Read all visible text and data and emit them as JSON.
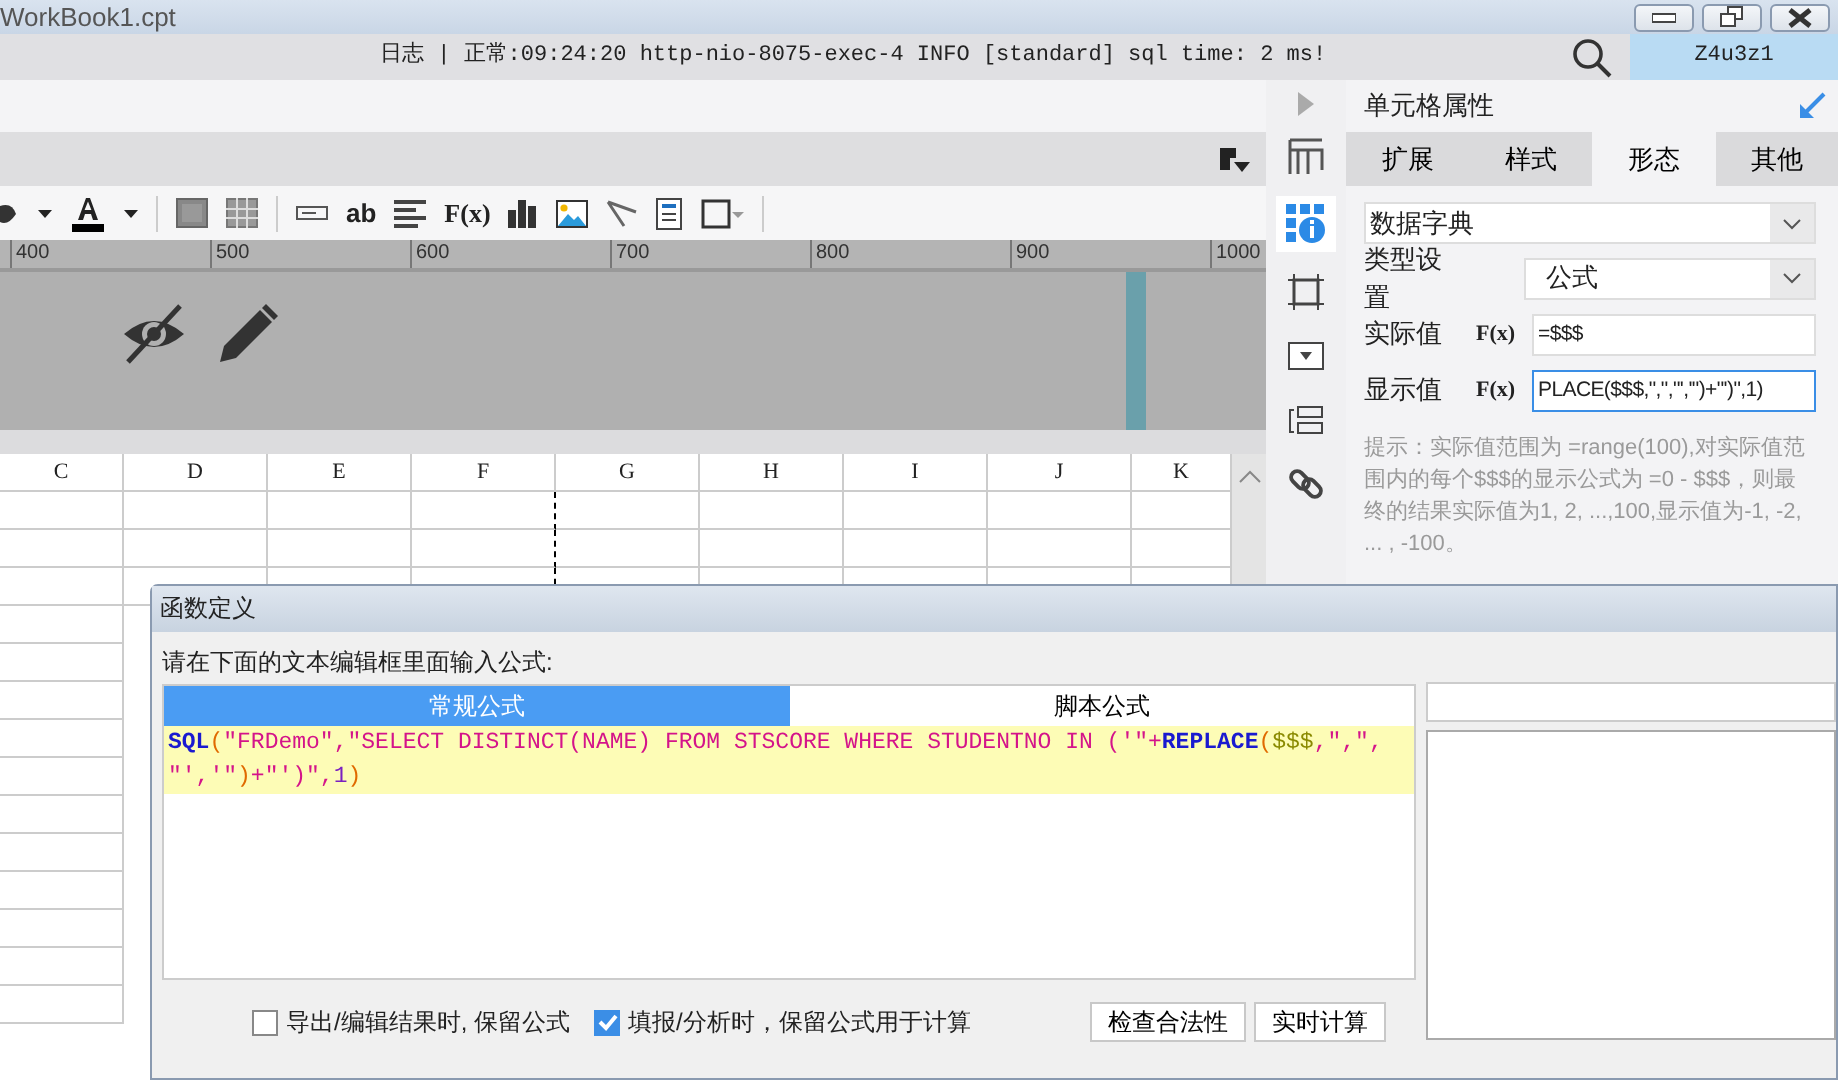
{
  "window": {
    "title": "WorkBook1.cpt"
  },
  "log_bar": {
    "label": "日志",
    "separator": "|",
    "message": "正常:09:24:20 http-nio-8075-exec-4 INFO [standard] sql time: 2 ms!",
    "user": "Z4u3z1"
  },
  "toolbar": {
    "text_tool": "ab",
    "formula_tool": "F(x)"
  },
  "ruler": {
    "ticks": [
      "400",
      "500",
      "600",
      "700",
      "800",
      "900",
      "1000"
    ]
  },
  "sheet": {
    "columns": [
      "C",
      "D",
      "E",
      "F",
      "G",
      "H",
      "I",
      "J",
      "K"
    ]
  },
  "property_panel": {
    "title": "单元格属性",
    "tabs": [
      {
        "label": "扩展",
        "selected": false
      },
      {
        "label": "样式",
        "selected": false
      },
      {
        "label": "形态",
        "selected": true
      },
      {
        "label": "其他",
        "selected": false
      }
    ],
    "form_type": "数据字典",
    "type_label": "类型设置",
    "type_value": "公式",
    "fields": [
      {
        "label": "实际值",
        "fx": "F(x)",
        "value": "=$$$",
        "focused": false
      },
      {
        "label": "显示值",
        "fx": "F(x)",
        "value": "PLACE($$$,\",\",\"','\")+\"')\",1)",
        "focused": true
      }
    ],
    "hint": "提示：实际值范围为 =range(100),对实际值范围内的每个$$$的显示公式为 =0 - $$$，则最终的结果实际值为1, 2, ...,100,显示值为-1, -2, ... , -100。"
  },
  "dialog": {
    "title": "函数定义",
    "prompt": "请在下面的文本编辑框里面输入公式:",
    "tabs": [
      {
        "label": "常规公式",
        "selected": true
      },
      {
        "label": "脚本公式",
        "selected": false
      }
    ],
    "formula_lines": [
      [
        {
          "text": "SQL",
          "kind": "function"
        },
        {
          "text": "(",
          "kind": "paren"
        },
        {
          "text": "\"FRDemo\",\"SELECT DISTINCT(NAME) FROM STSCORE WHERE STUDENTNO IN ('\"+",
          "kind": "string"
        },
        {
          "text": "REPLACE",
          "kind": "function"
        },
        {
          "text": "(",
          "kind": "paren"
        },
        {
          "text": "$$$",
          "kind": "parameter"
        },
        {
          "text": ",\",\",",
          "kind": "string"
        }
      ],
      [
        {
          "text": "\"','\"",
          "kind": "string"
        },
        {
          "text": ")",
          "kind": "paren"
        },
        {
          "text": "+\"')\",",
          "kind": "string"
        },
        {
          "text": "1",
          "kind": "number"
        },
        {
          "text": ")",
          "kind": "paren"
        }
      ]
    ],
    "options": [
      {
        "label": "导出/编辑结果时, 保留公式",
        "checked": false
      },
      {
        "label": "填报/分析时，保留公式用于计算",
        "checked": true
      }
    ],
    "buttons": [
      "检查合法性",
      "实时计算"
    ]
  }
}
